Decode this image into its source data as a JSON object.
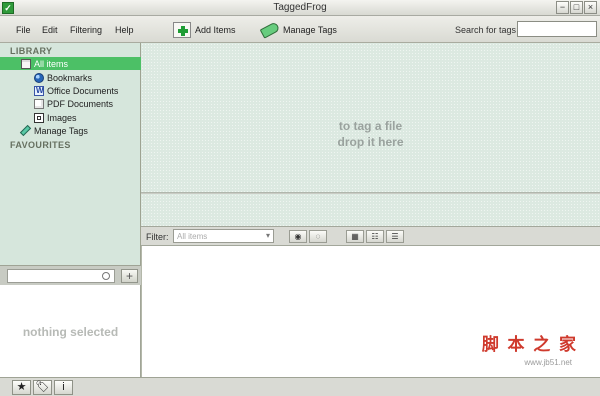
{
  "window": {
    "title": "TaggedFrog",
    "minimize_glyph": "−",
    "maximize_glyph": "□",
    "close_glyph": "×",
    "app_icon_glyph": "✓"
  },
  "menubar": {
    "items": [
      "File",
      "Edit",
      "Filtering",
      "Help"
    ],
    "toolbar": {
      "add_items": "Add Items",
      "manage_tags": "Manage Tags"
    },
    "search": {
      "label": "Search for tags",
      "value": "",
      "placeholder": ""
    }
  },
  "sidebar": {
    "library_header": "LIBRARY",
    "items": [
      {
        "label": "All items",
        "icon": "all-items-icon",
        "selected": true
      },
      {
        "label": "Bookmarks",
        "icon": "globe-icon",
        "selected": false
      },
      {
        "label": "Office Documents",
        "icon": "office-document-icon",
        "selected": false
      },
      {
        "label": "PDF Documents",
        "icon": "pdf-document-icon",
        "selected": false
      },
      {
        "label": "Images",
        "icon": "image-icon",
        "selected": false
      },
      {
        "label": "Manage Tags",
        "icon": "tag-pen-icon",
        "selected": false
      }
    ],
    "favourites_header": "FAVOURITES"
  },
  "drop_zone": {
    "line1": "to tag a file",
    "line2": "drop it here"
  },
  "filter_bar": {
    "label": "Filter:",
    "selected": "All items",
    "placeholder": "All items",
    "options": [
      "All items"
    ],
    "buttons": [
      "filter-toggle-1",
      "filter-toggle-2",
      "view-thumbnails",
      "view-list",
      "view-details"
    ]
  },
  "tag_panel": {
    "search_value": "",
    "placeholder": "",
    "add_label": "+"
  },
  "details": {
    "empty_text": "nothing selected"
  },
  "bottom_toolbar": {
    "favourite_glyph": "★",
    "tag_glyph": "🏷",
    "info_glyph": "i"
  },
  "watermark": {
    "main": "脚 本 之 家",
    "sub": "www.jb51.net"
  },
  "colors": {
    "accent": "#4cc066",
    "sidebar_bg": "#d6e6dc",
    "drop_bg": "#dce9e1"
  }
}
